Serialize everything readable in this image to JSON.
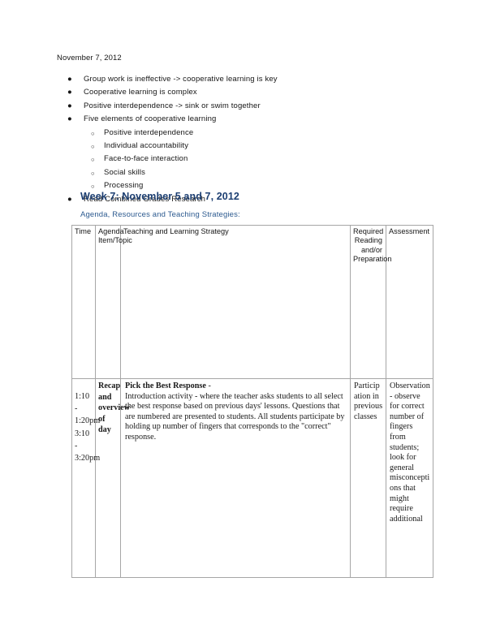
{
  "document": {
    "date_line": "November 7, 2012"
  },
  "notes": {
    "bullets": [
      {
        "level": 1,
        "marker": "●",
        "text": "Group work is ineffective -> cooperative learning is key"
      },
      {
        "level": 1,
        "marker": "●",
        "text": "Cooperative learning is complex"
      },
      {
        "level": 1,
        "marker": "●",
        "text": "Positive interdependence -> sink or swim together"
      },
      {
        "level": 1,
        "marker": "●",
        "text": "Five elements of cooperative learning"
      },
      {
        "level": 2,
        "marker": "○",
        "text": "Positive interdependence"
      },
      {
        "level": 2,
        "marker": "○",
        "text": "Individual accountability"
      },
      {
        "level": 2,
        "marker": "○",
        "text": "Face-to-face interaction"
      },
      {
        "level": 2,
        "marker": "○",
        "text": "Social skills"
      },
      {
        "level": 2,
        "marker": "○",
        "text": "Processing"
      },
      {
        "level": 1,
        "marker": "●",
        "text": "Read Combined Grades Research"
      }
    ]
  },
  "section": {
    "heading": "Week 7: November 5 and 7, 2012",
    "heading_color": "#1d3f72",
    "subtitle": "Agenda, Resources and Teaching Strategies:",
    "subtitle_color": "#2c5a8f"
  },
  "table": {
    "border_color": "#a6a6a6",
    "headers": {
      "time": "Time",
      "agenda_item": "Agenda Item/Topic",
      "strategy": "Teaching and Learning Strategy",
      "required_reading": "Required Reading and/or Preparation",
      "assessment": "Assessment"
    },
    "rows": [
      {
        "time": "1:10 - 1:20pm 3:10 - 3:20pm",
        "agenda_item": "Recap and overview of day",
        "strategy_title": "Pick the Best Response",
        "strategy_separator": " - ",
        "strategy_body": "Introduction activity - where the teacher asks students to all select the best response based on previous days' lessons. Questions that are numbered are presented to students. All students participate by holding up number of fingers that corresponds to the \"correct\" response.",
        "required_reading": "Participation in previous classes",
        "assessment": "Observation - observe for correct number of fingers from students; look for general misconceptions that might require additional"
      }
    ]
  }
}
